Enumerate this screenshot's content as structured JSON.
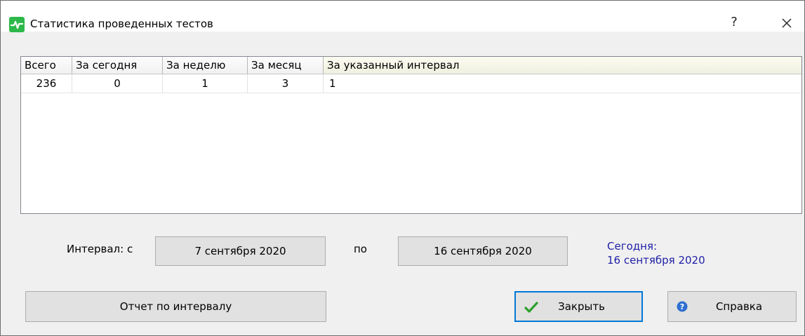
{
  "window": {
    "title": "Статистика проведенных тестов",
    "help_glyph": "?",
    "icons": {
      "app": "heartbeat-icon",
      "close": "close-icon"
    }
  },
  "table": {
    "columns": [
      "Всего",
      "За сегодня",
      "За неделю",
      "За месяц",
      "За указанный интервал"
    ],
    "rows": [
      [
        "236",
        "0",
        "1",
        "3",
        "1"
      ]
    ]
  },
  "interval": {
    "label_from": "Интервал: с",
    "from_value": "7 сентября 2020",
    "label_to": "по",
    "to_value": "16 сентября 2020"
  },
  "today": {
    "label": "Сегодня:",
    "value": "16 сентября 2020",
    "color": "#1f1fa8"
  },
  "buttons": {
    "report": "Отчет по интервалу",
    "close": "Закрыть",
    "help": "Справка"
  },
  "colors": {
    "accent": "#0078d7",
    "app_icon": "#2db84a",
    "check": "#2aa02a",
    "help_icon": "#2f6fd1"
  }
}
